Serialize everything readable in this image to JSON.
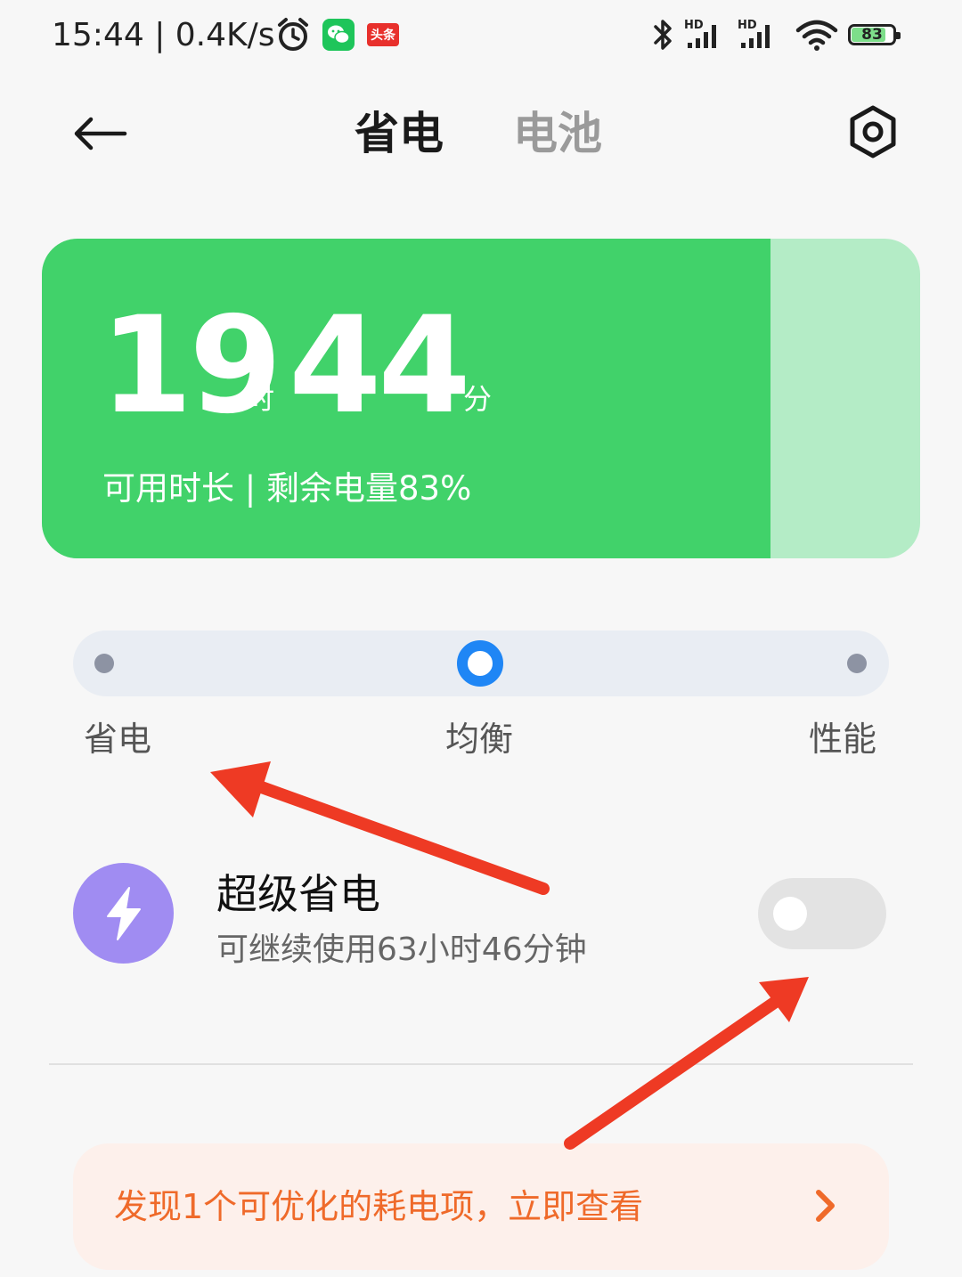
{
  "status_bar": {
    "time_speed": "15:44 | 0.4K/s",
    "news_badge": "头条",
    "battery_level": "83"
  },
  "header": {
    "tabs": [
      {
        "label": "省电",
        "active": true
      },
      {
        "label": "电池",
        "active": false
      }
    ]
  },
  "battery_card": {
    "hours": "19",
    "hours_unit": "时",
    "minutes": "44",
    "minutes_unit": "分",
    "subtitle": "可用时长 | 剩余电量83%",
    "level_percent": 83
  },
  "mode_selector": {
    "options": [
      "省电",
      "均衡",
      "性能"
    ],
    "selected": "均衡"
  },
  "super_saving": {
    "title": "超级省电",
    "subtitle": "可继续使用63小时46分钟",
    "enabled": false
  },
  "optimize_banner": {
    "text": "发现1个可优化的耗电项，立即查看"
  },
  "colors": {
    "battery_green": "#41d26a",
    "battery_empty": "#b4ecc6",
    "accent_blue": "#1f86f5",
    "super_purple": "#a08cf2",
    "banner_orange": "#ef6a2a",
    "annotation_red": "#ee3a24"
  },
  "icons": {
    "back": "arrow-left-icon",
    "settings": "settings-hexagon-icon",
    "super_saving": "lightning-bolt-icon",
    "banner": "chevron-right-icon"
  }
}
